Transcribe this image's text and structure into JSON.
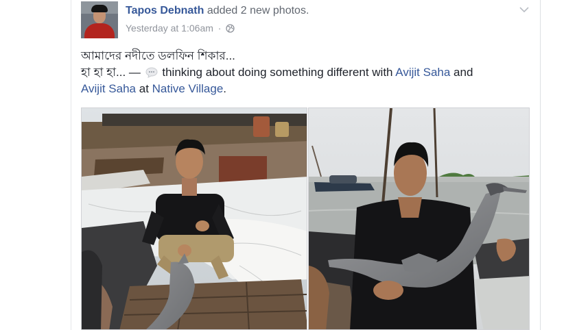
{
  "post": {
    "author": "Tapos Debnath",
    "action": "added 2 new photos.",
    "timestamp": "Yesterday at 1:06am",
    "separator": "·",
    "privacy_icon": "globe-icon",
    "options_icon": "chevron-down-icon",
    "message_line1": "আমাদের নদীতে ডলফিন শিকার...",
    "message_line2_prefix": "হা হা হা... — ",
    "activity_icon": "speech-bubble-icon",
    "activity_text": " thinking about doing something different with ",
    "tagged_1": "Avijit Saha",
    "connector_and": " and",
    "tagged_2": "Avijit Saha",
    "connector_at": " at ",
    "place": "Native Village",
    "end": "."
  },
  "photos": [
    {
      "name": "photo-boat-net"
    },
    {
      "name": "photo-river-dolphin"
    }
  ],
  "colors": {
    "link": "#365899",
    "meta": "#90949c",
    "text": "#1d2129",
    "action": "#616770"
  }
}
